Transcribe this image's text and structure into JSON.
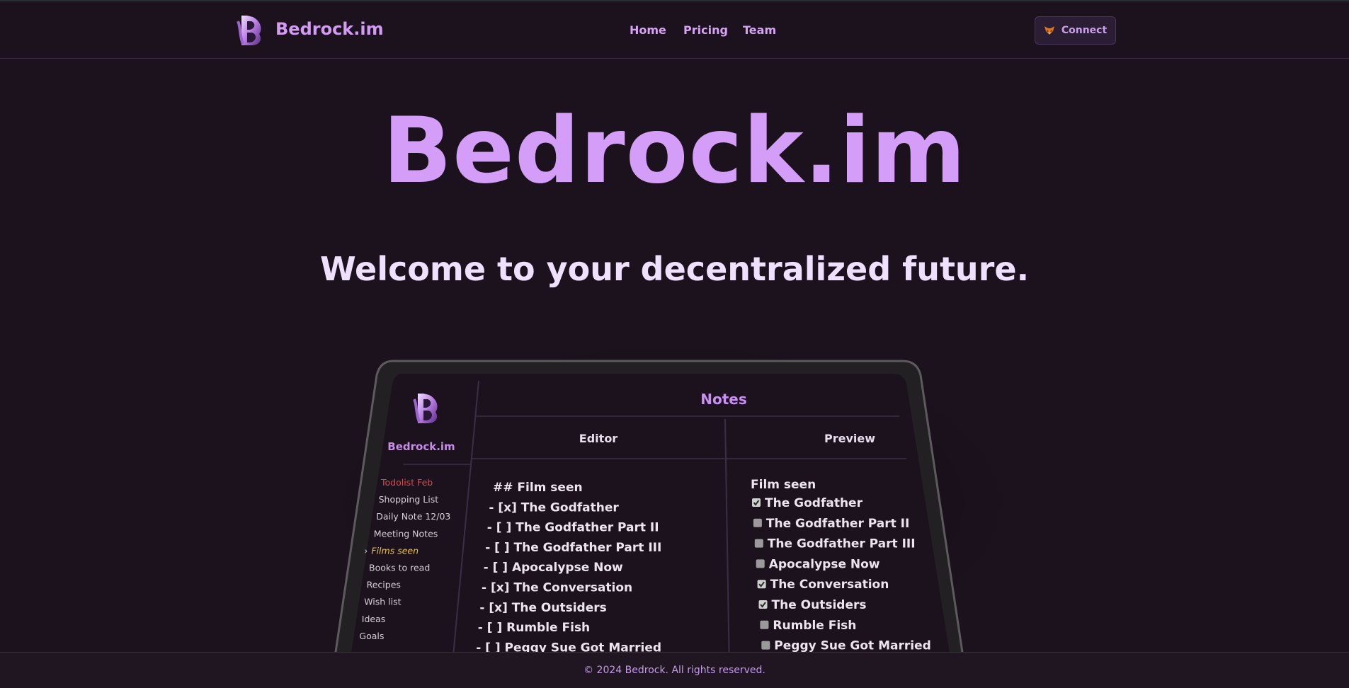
{
  "header": {
    "brand": "Bedrock.im",
    "nav": [
      "Home",
      "Pricing",
      "Team"
    ],
    "connect_label": "Connect",
    "connect_icon": "fox-icon"
  },
  "hero": {
    "title": "Bedrock.im",
    "subtitle": "Welcome to your decentralized future."
  },
  "app_preview": {
    "brand": "Bedrock.im",
    "panel_title": "Notes",
    "editor_label": "Editor",
    "preview_label": "Preview",
    "sidebar_items": [
      {
        "label": "Todolist Feb",
        "state": "red"
      },
      {
        "label": "Shopping List",
        "state": "normal"
      },
      {
        "label": "Daily Note 12/03",
        "state": "normal"
      },
      {
        "label": "Meeting Notes",
        "state": "normal"
      },
      {
        "label": "Films seen",
        "state": "active"
      },
      {
        "label": "Books to read",
        "state": "normal"
      },
      {
        "label": "Recipes",
        "state": "normal"
      },
      {
        "label": "Wish list",
        "state": "normal"
      },
      {
        "label": "Ideas",
        "state": "normal"
      },
      {
        "label": "Goals",
        "state": "normal"
      }
    ],
    "editor_lines": [
      "## Film seen",
      "- [x] The Godfather",
      "- [ ] The Godfather Part II",
      "- [ ] The Godfather Part III",
      "- [ ] Apocalypse Now",
      "- [x] The Conversation",
      "- [x] The Outsiders",
      "- [ ] Rumble Fish",
      "- [ ] Peggy Sue Got Married"
    ],
    "preview_heading": "Film seen",
    "preview_items": [
      {
        "label": "The Godfather",
        "checked": true
      },
      {
        "label": "The Godfather Part II",
        "checked": false
      },
      {
        "label": "The Godfather Part III",
        "checked": false
      },
      {
        "label": "Apocalypse Now",
        "checked": false
      },
      {
        "label": "The Conversation",
        "checked": true
      },
      {
        "label": "The Outsiders",
        "checked": true
      },
      {
        "label": "Rumble Fish",
        "checked": false
      },
      {
        "label": "Peggy Sue Got Married",
        "checked": false
      }
    ]
  },
  "footer": {
    "copyright": "© 2024 Bedrock. All rights reserved."
  },
  "colors": {
    "background": "#1c121e",
    "accent": "#d49ef8",
    "sidebar_red": "#e0474a",
    "sidebar_active": "#e8c34a"
  }
}
